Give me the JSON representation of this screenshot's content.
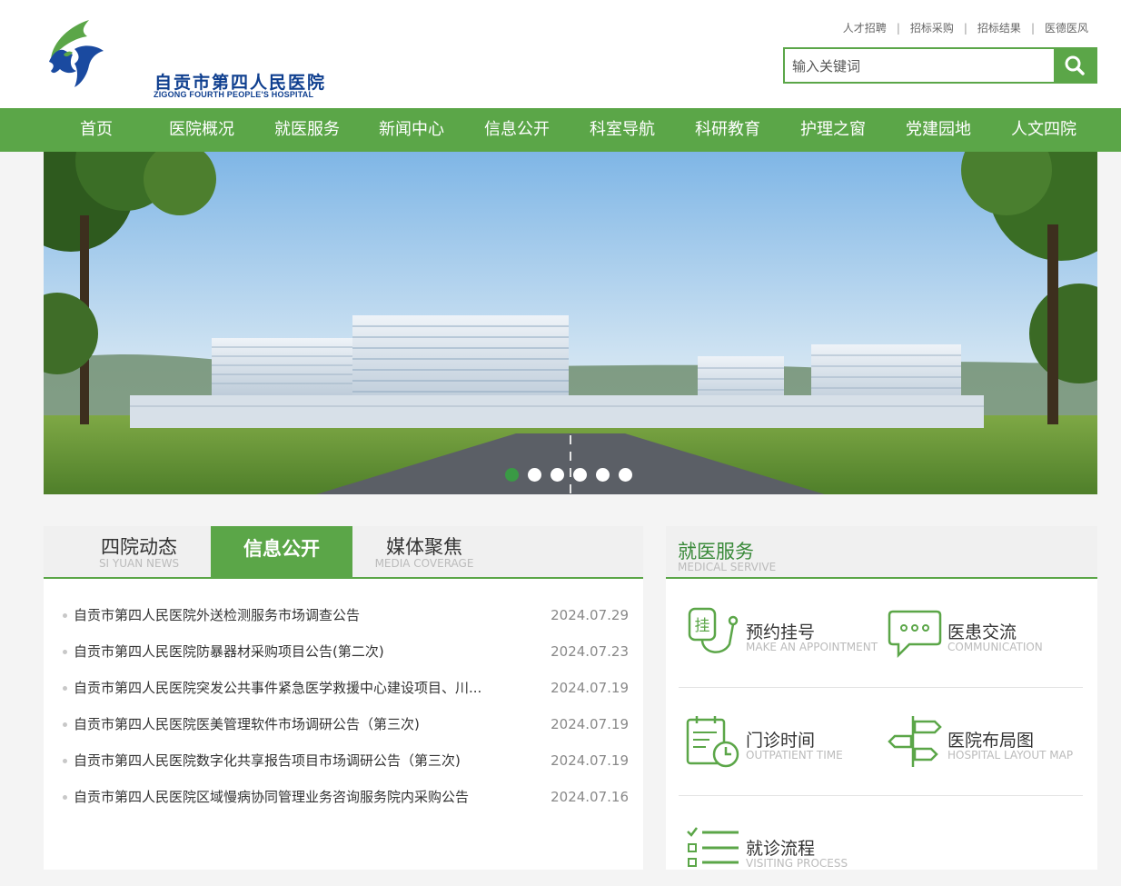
{
  "brand": {
    "name_cn": "自贡市第四人民医院",
    "name_en": "ZIGONG FOURTH PEOPLE'S HOSPITAL",
    "primary_color": "#5ba648"
  },
  "top_links": [
    "人才招聘",
    "招标采购",
    "招标结果",
    "医德医风"
  ],
  "top_links_separator": "|",
  "search": {
    "placeholder": "输入关键词",
    "icon": "search-icon"
  },
  "nav": {
    "items": [
      "首页",
      "医院概况",
      "就医服务",
      "新闻中心",
      "信息公开",
      "科室导航",
      "科研教育",
      "护理之窗",
      "党建园地",
      "人文四院"
    ]
  },
  "banner": {
    "slide_count": 6,
    "active_slide": 1,
    "image_description_icon": "hospital-building-illustration"
  },
  "news": {
    "tabs": [
      {
        "cn": "四院动态",
        "en": "SI YUAN NEWS",
        "active": false
      },
      {
        "cn": "信息公开",
        "en": "",
        "active": true
      },
      {
        "cn": "媒体聚焦",
        "en": "MEDIA COVERAGE",
        "active": false
      }
    ],
    "items": [
      {
        "title": "自贡市第四人民医院外送检测服务市场调查公告",
        "date": "2024.07.29"
      },
      {
        "title": "自贡市第四人民医院防暴器材采购项目公告(第二次)",
        "date": "2024.07.23"
      },
      {
        "title": "自贡市第四人民医院突发公共事件紧急医学救援中心建设项目、川...",
        "date": "2024.07.19"
      },
      {
        "title": "自贡市第四人民医院医美管理软件市场调研公告（第三次)",
        "date": "2024.07.19"
      },
      {
        "title": "自贡市第四人民医院数字化共享报告项目市场调研公告（第三次)",
        "date": "2024.07.19"
      },
      {
        "title": "自贡市第四人民医院区域慢病协同管理业务咨询服务院内采购公告",
        "date": "2024.07.16"
      }
    ]
  },
  "services": {
    "heading_cn": "就医服务",
    "heading_en": "MEDICAL SERVIVE",
    "items": [
      {
        "cn": "预约挂号",
        "en": "MAKE AN APPOINTMENT",
        "icon": "appointment-icon",
        "icon_char": "挂"
      },
      {
        "cn": "医患交流",
        "en": "COMMUNICATION",
        "icon": "chat-bubble-icon"
      },
      {
        "cn": "门诊时间",
        "en": "OUTPATIENT TIME",
        "icon": "clock-calendar-icon"
      },
      {
        "cn": "医院布局图",
        "en": "HOSPITAL LAYOUT MAP",
        "icon": "signpost-icon"
      },
      {
        "cn": "就诊流程",
        "en": "VISITING PROCESS",
        "icon": "checklist-icon"
      }
    ]
  }
}
